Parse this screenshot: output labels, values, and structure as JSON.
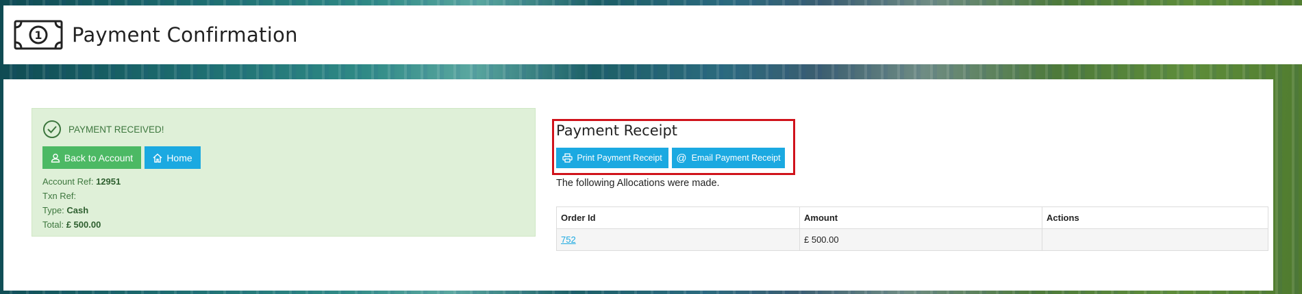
{
  "header": {
    "title": "Payment Confirmation",
    "icon": "money-bill-icon"
  },
  "alert": {
    "status": "PAYMENT RECEIVED!",
    "back_button": "Back to Account",
    "home_button": "Home",
    "account_ref_label": "Account Ref:",
    "account_ref_value": "12951",
    "txn_ref_label": "Txn Ref:",
    "txn_ref_value": "",
    "type_label": "Type:",
    "type_value": "Cash",
    "total_label": "Total:",
    "total_value": "£ 500.00"
  },
  "receipt": {
    "title": "Payment Receipt",
    "print_button": "Print Payment Receipt",
    "email_button": "Email Payment Receipt",
    "allocations_text": "The following Allocations were made."
  },
  "table": {
    "columns": [
      "Order Id",
      "Amount",
      "Actions"
    ],
    "rows": [
      {
        "order_id": "752",
        "amount": "£ 500.00",
        "actions": ""
      }
    ]
  },
  "colors": {
    "success": "#4cb964",
    "info": "#1ba9e1",
    "alert_bg": "#dff0d8",
    "highlight": "#d0121b"
  }
}
